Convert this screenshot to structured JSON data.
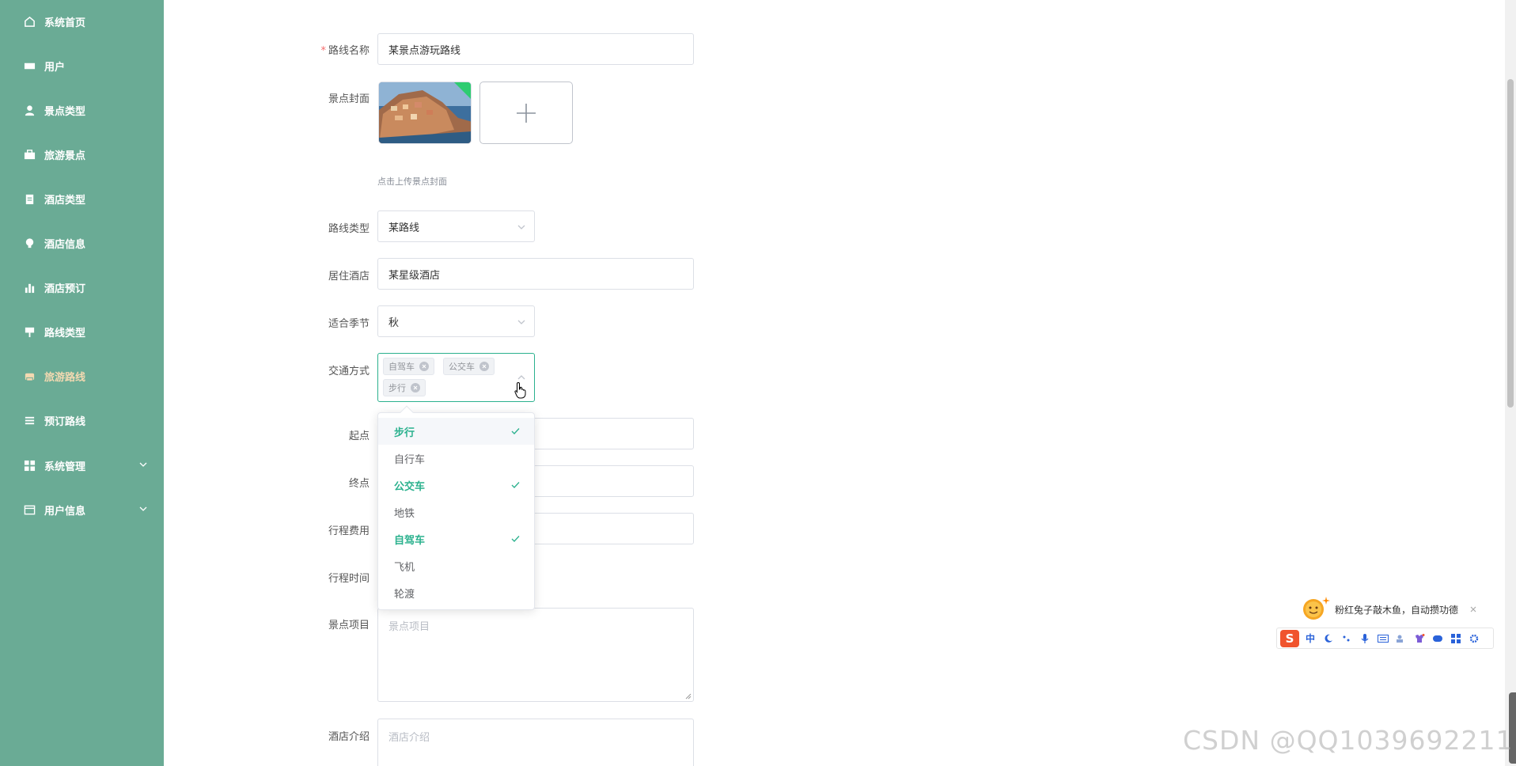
{
  "sidebar": {
    "items": [
      {
        "label": "系统首页",
        "icon": "home-icon"
      },
      {
        "label": "用户",
        "icon": "ticket-icon"
      },
      {
        "label": "景点类型",
        "icon": "person-icon"
      },
      {
        "label": "旅游景点",
        "icon": "briefcase-icon"
      },
      {
        "label": "酒店类型",
        "icon": "clipboard-icon"
      },
      {
        "label": "酒店信息",
        "icon": "bulb-icon"
      },
      {
        "label": "酒店预订",
        "icon": "bar-chart-icon"
      },
      {
        "label": "路线类型",
        "icon": "sign-icon"
      },
      {
        "label": "旅游路线",
        "icon": "printer-icon",
        "active": true
      },
      {
        "label": "预订路线",
        "icon": "list-icon"
      },
      {
        "label": "系统管理",
        "icon": "grid-icon",
        "expandable": true
      },
      {
        "label": "用户信息",
        "icon": "card-icon",
        "expandable": true
      }
    ],
    "active_color": "#f3d9b1"
  },
  "form": {
    "route_name": {
      "label": "路线名称",
      "value": "某景点游玩路线",
      "required_mark": "*"
    },
    "cover": {
      "label": "景点封面",
      "hint": "点击上传景点封面"
    },
    "route_type": {
      "label": "路线类型",
      "value": "某路线"
    },
    "hotel": {
      "label": "居住酒店",
      "value": "某星级酒店"
    },
    "season": {
      "label": "适合季节",
      "value": "秋"
    },
    "transport": {
      "label": "交通方式",
      "tags": [
        "自驾车",
        "公交车",
        "步行"
      ]
    },
    "start": {
      "label": "起点"
    },
    "end": {
      "label": "终点"
    },
    "cost": {
      "label": "行程费用"
    },
    "duration": {
      "label": "行程时间"
    },
    "items": {
      "label": "景点项目",
      "placeholder": "景点项目"
    },
    "hotel_intro": {
      "label": "酒店介绍",
      "placeholder": "酒店介绍"
    }
  },
  "dropdown": {
    "options": [
      {
        "label": "步行",
        "selected": true
      },
      {
        "label": "自行车",
        "selected": false
      },
      {
        "label": "公交车",
        "selected": true
      },
      {
        "label": "地铁",
        "selected": false
      },
      {
        "label": "自驾车",
        "selected": true
      },
      {
        "label": "飞机",
        "selected": false
      },
      {
        "label": "轮渡",
        "selected": false
      }
    ],
    "selected_color": "#2bb18e"
  },
  "ime": {
    "message": "粉红兔子敲木鱼，自动攒功德",
    "mode": "中"
  },
  "watermark": "CSDN @QQ1039692211",
  "colors": {
    "sidebar": "#6aab95",
    "accent": "#2bb18e"
  }
}
